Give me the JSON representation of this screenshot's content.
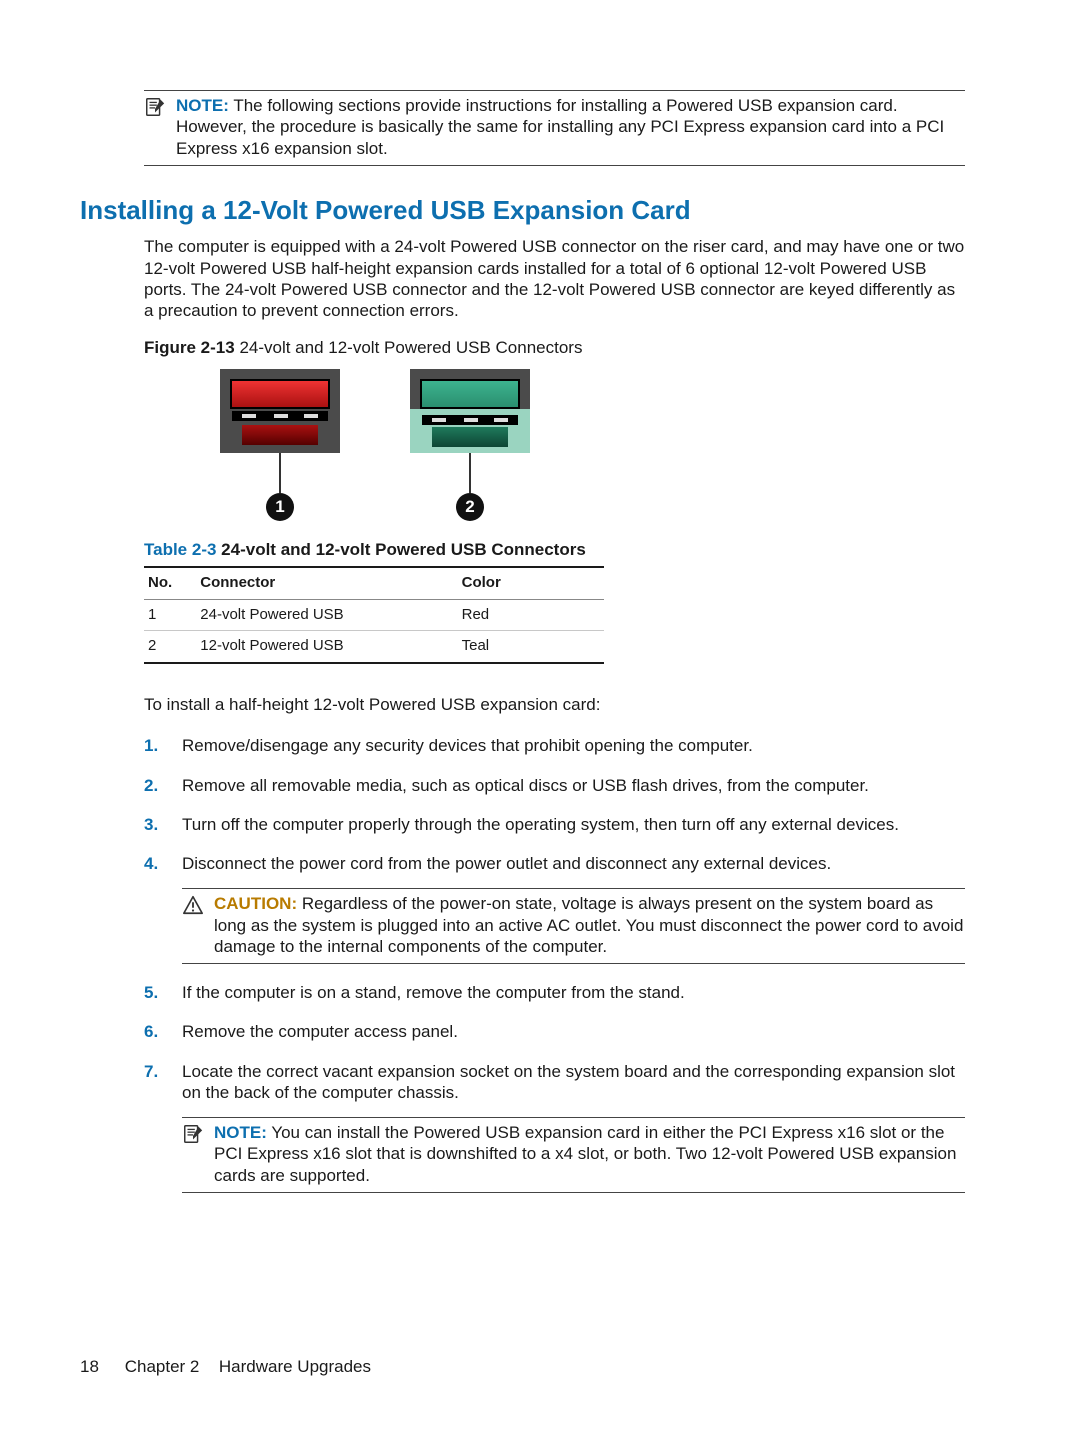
{
  "topNote": {
    "label": "NOTE:",
    "text": "The following sections provide instructions for installing a Powered USB expansion card. However, the procedure is basically the same for installing any PCI Express expansion card into a PCI Express x16 expansion slot."
  },
  "heading": "Installing a 12-Volt Powered USB Expansion Card",
  "intro": "The computer is equipped with a 24-volt Powered USB connector on the riser card, and may have one or two 12-volt Powered USB half-height expansion cards installed for a total of 6 optional 12-volt Powered USB ports. The 24-volt Powered USB connector and the 12-volt Powered USB connector are keyed differently as a precaution to prevent connection errors.",
  "figure": {
    "label": "Figure 2-13",
    "caption": "24-volt and 12-volt Powered USB Connectors",
    "callouts": {
      "left": "1",
      "right": "2"
    }
  },
  "table": {
    "label": "Table 2-3",
    "caption": "24-volt and 12-volt Powered USB Connectors",
    "headers": {
      "no": "No.",
      "connector": "Connector",
      "color": "Color"
    },
    "rows": [
      {
        "no": "1",
        "connector": "24-volt Powered USB",
        "color": "Red"
      },
      {
        "no": "2",
        "connector": "12-volt Powered USB",
        "color": "Teal"
      }
    ]
  },
  "stepsIntro": "To install a half-height 12-volt Powered USB expansion card:",
  "steps": [
    "Remove/disengage any security devices that prohibit opening the computer.",
    "Remove all removable media, such as optical discs or USB flash drives, from the computer.",
    "Turn off the computer properly through the operating system, then turn off any external devices.",
    "Disconnect the power cord from the power outlet and disconnect any external devices.",
    "If the computer is on a stand, remove the computer from the stand.",
    "Remove the computer access panel.",
    "Locate the correct vacant expansion socket on the system board and the corresponding expansion slot on the back of the computer chassis."
  ],
  "caution": {
    "label": "CAUTION:",
    "text": "Regardless of the power-on state, voltage is always present on the system board as long as the system is plugged into an active AC outlet. You must disconnect the power cord to avoid damage to the internal components of the computer."
  },
  "bottomNote": {
    "label": "NOTE:",
    "text": "You can install the Powered USB expansion card in either the PCI Express x16 slot or the PCI Express x16 slot that is downshifted to a x4 slot, or both. Two 12-volt Powered USB expansion cards are supported."
  },
  "footer": {
    "page": "18",
    "chapter": "Chapter 2",
    "section": "Hardware Upgrades"
  },
  "chart_data": {
    "type": "table",
    "title": "24-volt and 12-volt Powered USB Connectors",
    "columns": [
      "No.",
      "Connector",
      "Color"
    ],
    "rows": [
      [
        "1",
        "24-volt Powered USB",
        "Red"
      ],
      [
        "2",
        "12-volt Powered USB",
        "Teal"
      ]
    ]
  }
}
